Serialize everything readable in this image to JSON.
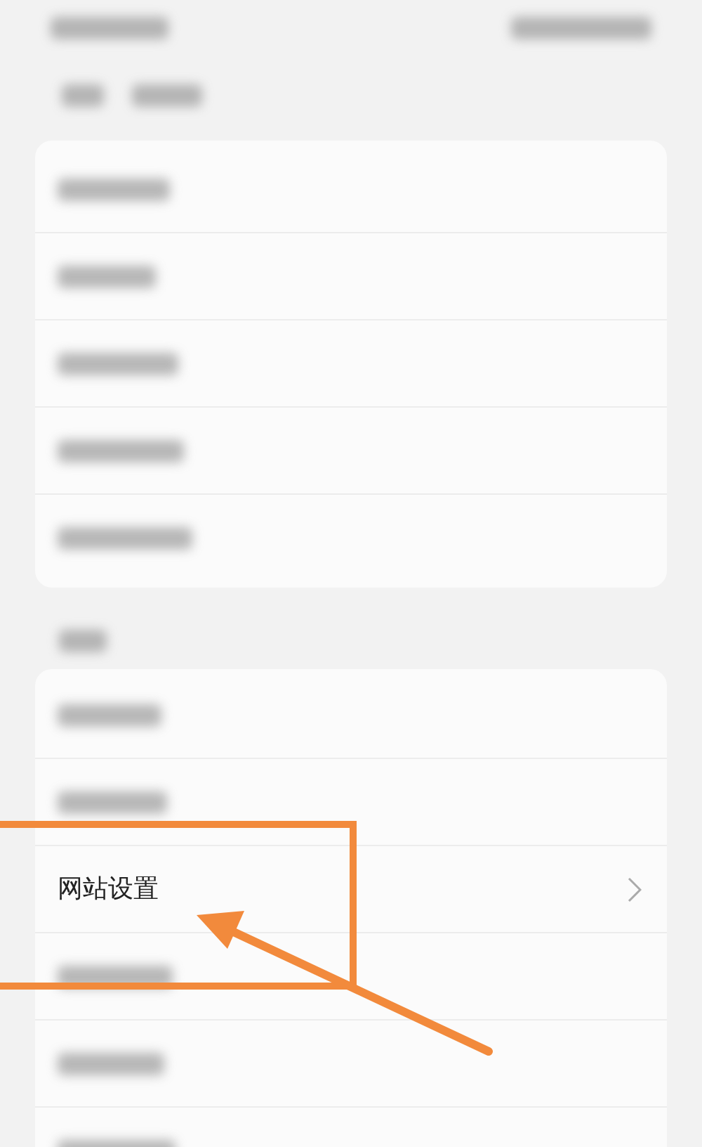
{
  "top_card": {
    "rows": [
      {
        "kind": "blurred"
      },
      {
        "kind": "blurred"
      },
      {
        "kind": "blurred"
      },
      {
        "kind": "blurred"
      },
      {
        "kind": "blurred"
      }
    ]
  },
  "section_header": {
    "kind": "blurred"
  },
  "settings_card": {
    "rows": [
      {
        "kind": "blurred"
      },
      {
        "kind": "blurred"
      },
      {
        "kind": "item",
        "label": "网站设置"
      },
      {
        "kind": "blurred"
      },
      {
        "kind": "blurred"
      },
      {
        "kind": "blurred"
      }
    ]
  },
  "annotation": {
    "kind": "box-and-arrow"
  }
}
